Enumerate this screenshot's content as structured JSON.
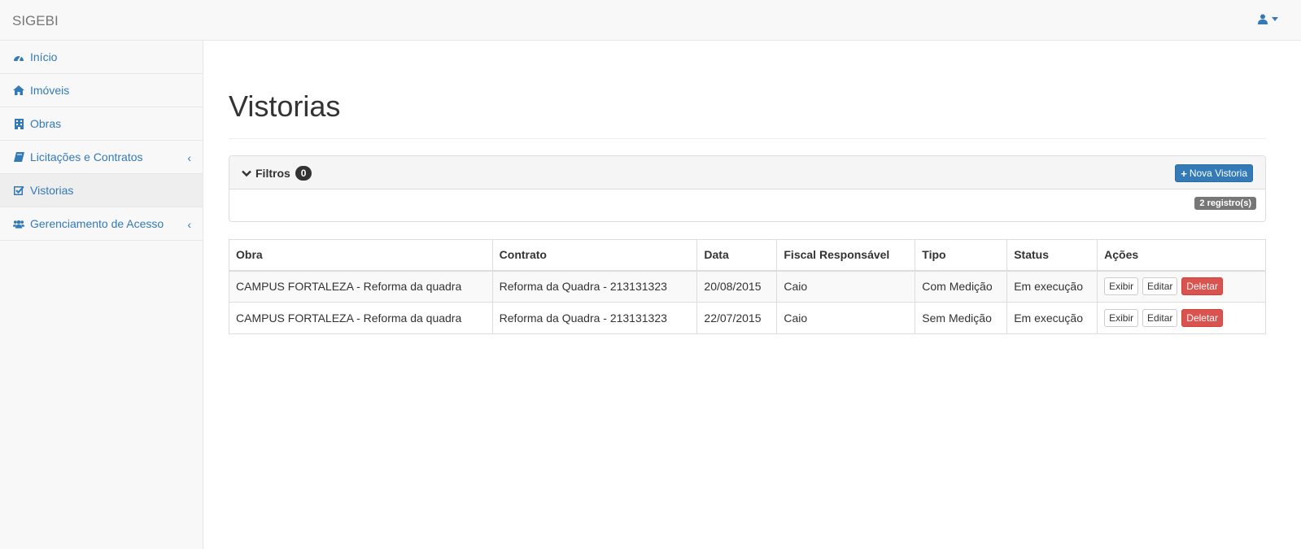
{
  "app": {
    "brand": "SIGEBI"
  },
  "colors": {
    "link": "#337ab7",
    "primary": "#337ab7",
    "danger": "#d9534f"
  },
  "sidebar": {
    "items": [
      {
        "label": "Início",
        "icon": "dashboard-icon"
      },
      {
        "label": "Imóveis",
        "icon": "home-icon"
      },
      {
        "label": "Obras",
        "icon": "building-icon"
      },
      {
        "label": "Licitações e Contratos",
        "icon": "book-icon",
        "expandable": true
      },
      {
        "label": "Vistorias",
        "icon": "check-square-icon",
        "active": true
      },
      {
        "label": "Gerenciamento de Acesso",
        "icon": "users-icon",
        "expandable": true
      }
    ]
  },
  "page": {
    "title": "Vistorias"
  },
  "filters": {
    "label": "Filtros",
    "count": "0",
    "new_button": "Nova Vistoria",
    "records": "2 registro(s)"
  },
  "table": {
    "headers": [
      "Obra",
      "Contrato",
      "Data",
      "Fiscal Responsável",
      "Tipo",
      "Status",
      "Ações"
    ],
    "rows": [
      {
        "obra": "CAMPUS FORTALEZA - Reforma da quadra",
        "contrato": "Reforma da Quadra - 213131323",
        "data": "20/08/2015",
        "fiscal": "Caio",
        "tipo": "Com Medição",
        "status": "Em execução"
      },
      {
        "obra": "CAMPUS FORTALEZA - Reforma da quadra",
        "contrato": "Reforma da Quadra - 213131323",
        "data": "22/07/2015",
        "fiscal": "Caio",
        "tipo": "Sem Medição",
        "status": "Em execução"
      }
    ],
    "actions": {
      "view": "Exibir",
      "edit": "Editar",
      "delete": "Deletar"
    }
  }
}
